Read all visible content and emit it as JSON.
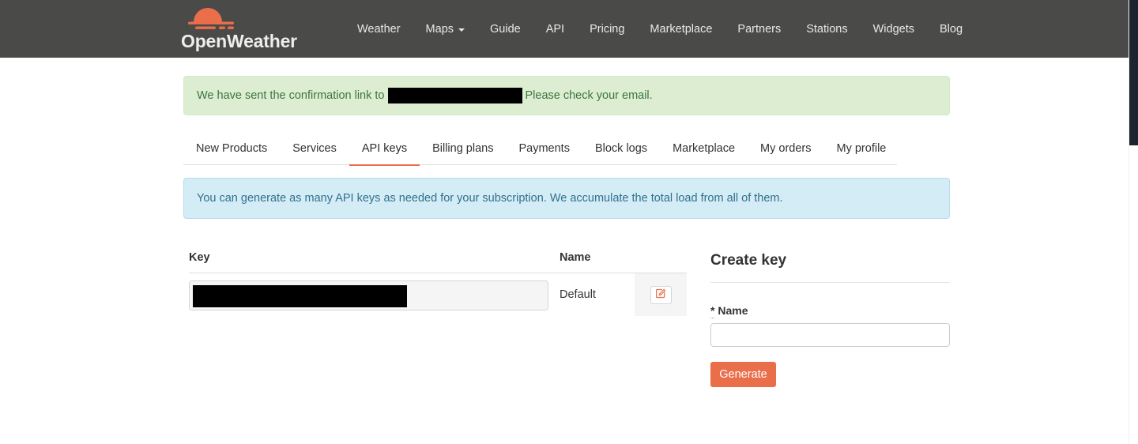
{
  "header": {
    "logo": {
      "name": "OpenWeather",
      "icon": "sun-cloud-icon",
      "color": "#eb6e4b"
    },
    "nav": [
      {
        "label": "Weather",
        "has_caret": false
      },
      {
        "label": "Maps",
        "has_caret": true
      },
      {
        "label": "Guide",
        "has_caret": false
      },
      {
        "label": "API",
        "has_caret": false
      },
      {
        "label": "Pricing",
        "has_caret": false
      },
      {
        "label": "Marketplace",
        "has_caret": false
      },
      {
        "label": "Partners",
        "has_caret": false
      },
      {
        "label": "Stations",
        "has_caret": false
      },
      {
        "label": "Widgets",
        "has_caret": false
      },
      {
        "label": "Blog",
        "has_caret": false
      }
    ],
    "background": "#4a4a48"
  },
  "alerts": {
    "success": {
      "text_before": "We have sent the confirmation link to",
      "redacted_value": "",
      "text_after": "Please check your email.",
      "background": "#dcedd2",
      "text_color": "#3c763d"
    },
    "info": {
      "text": "You can generate as many API keys as needed for your subscription. We accumulate the total load from all of them.",
      "background": "#d4ecf5",
      "text_color": "#31708f"
    }
  },
  "tabs": {
    "active": "API keys",
    "items": [
      {
        "label": "New Products"
      },
      {
        "label": "Services"
      },
      {
        "label": "API keys"
      },
      {
        "label": "Billing plans"
      },
      {
        "label": "Payments"
      },
      {
        "label": "Block logs"
      },
      {
        "label": "Marketplace"
      },
      {
        "label": "My orders"
      },
      {
        "label": "My profile"
      }
    ],
    "active_indicator_color": "#eb6e4b"
  },
  "keys_table": {
    "columns": [
      {
        "label": "Key"
      },
      {
        "label": "Name"
      }
    ],
    "rows": [
      {
        "key_value": "",
        "key_redacted": true,
        "name": "Default",
        "edit_icon": "edit-pencil-square-icon"
      }
    ]
  },
  "create_key": {
    "title": "Create key",
    "name_label_star": "*",
    "name_label": "Name",
    "name_value": "",
    "name_placeholder": "",
    "generate_label": "Generate",
    "button_color": "#eb6e4b"
  }
}
